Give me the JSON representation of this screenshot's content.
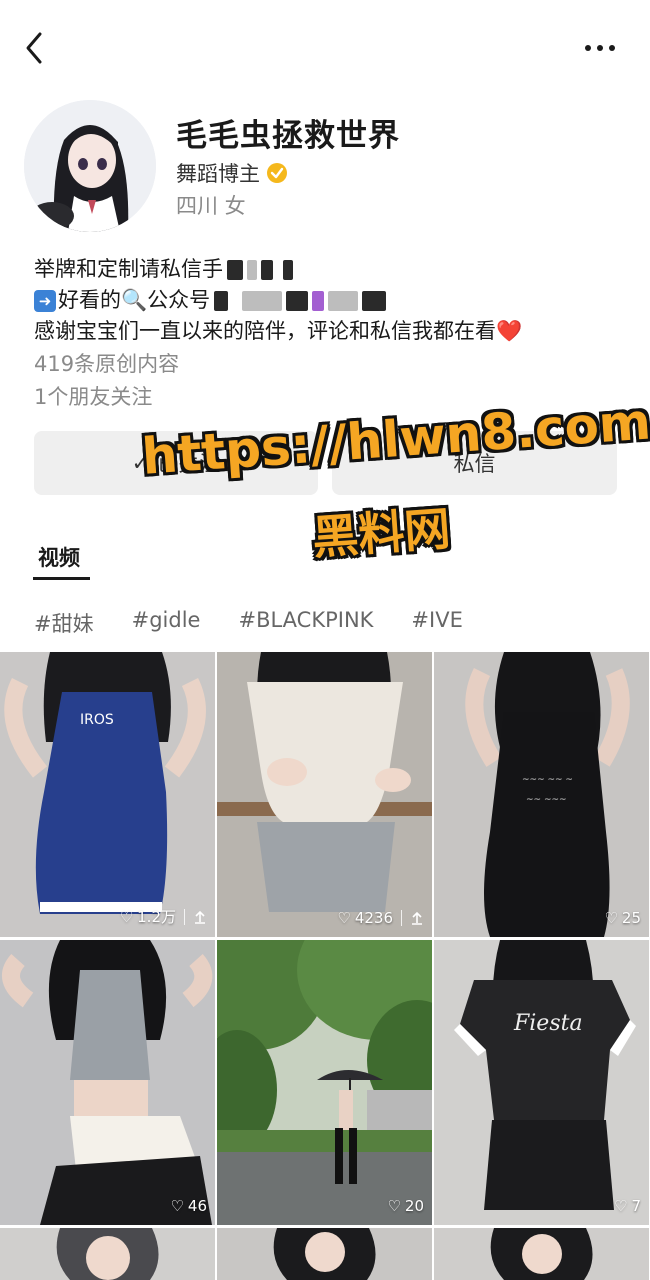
{
  "header": {
    "back_icon": "chevron-left-icon",
    "more_icon": "more-dots-icon"
  },
  "profile": {
    "name": "毛毛虫拯救世界",
    "role": "舞蹈博主",
    "location_gender": "四川 女",
    "verified_color": "#f5b81c"
  },
  "bio": {
    "line1": "举牌和定制请私信手",
    "line2_prefix": "好看的",
    "line2_suffix": "公众号",
    "line3": "感谢宝宝们一直以来的陪伴，评论和私信我都在看",
    "heart_emoji": "❤️",
    "original_count": "419条原创内容",
    "friends_follow": "1个朋友关注"
  },
  "actions": {
    "follow_label": "已关注",
    "message_label": "私信"
  },
  "watermark": {
    "url": "https://hlwn8.com",
    "name": "黑料网"
  },
  "tabs": {
    "video": "视频"
  },
  "tags": [
    "#甜妹",
    "#gidle",
    "#BLACKPINK",
    "#IVE"
  ],
  "videos": [
    {
      "likes": "1.2万",
      "shared": true
    },
    {
      "likes": "4236",
      "shared": true
    },
    {
      "likes": "25",
      "shared": false
    },
    {
      "likes": "46",
      "shared": false
    },
    {
      "likes": "20",
      "shared": false
    },
    {
      "likes": "7",
      "shared": false
    }
  ],
  "colors": {
    "accent": "#f5a623",
    "button_bg": "#efefef"
  }
}
